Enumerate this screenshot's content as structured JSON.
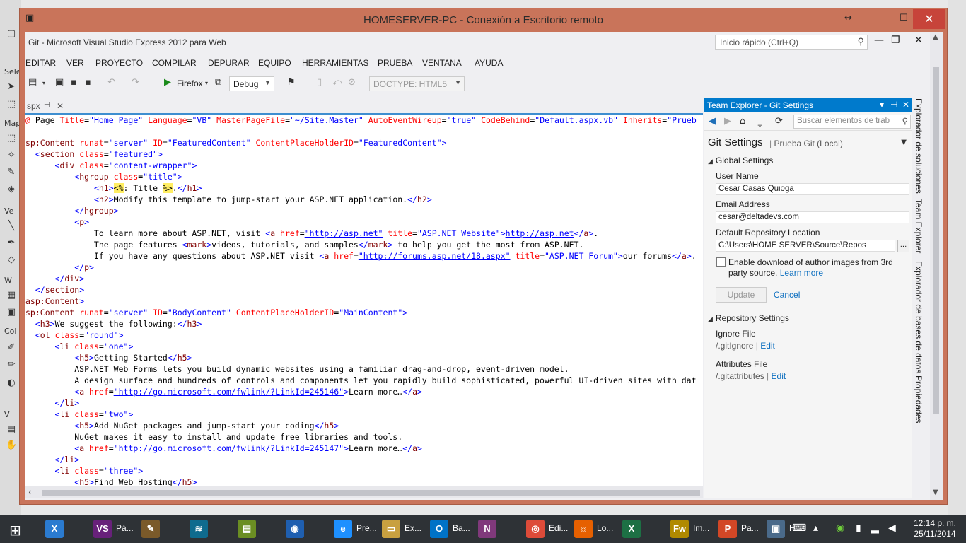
{
  "rdp": {
    "title": "HOMESERVER-PC - Conexión a Escritorio remoto"
  },
  "vs": {
    "title": "Git - Microsoft Visual Studio Express 2012 para Web",
    "quick_launch_placeholder": "Inicio rápido (Ctrl+Q)",
    "menu": [
      "EDITAR",
      "VER",
      "PROYECTO",
      "COMPILAR",
      "DEPURAR",
      "EQUIPO",
      "HERRAMIENTAS",
      "PRUEBA",
      "VENTANA",
      "AYUDA"
    ],
    "toolbar": {
      "browser": "Firefox",
      "config": "Debug",
      "doctype": "DOCTYPE: HTML5"
    },
    "doc_tab": "spx"
  },
  "code": [
    [
      [
        "at",
        "@ "
      ],
      [
        "txt",
        "Page "
      ],
      [
        "at",
        "Title"
      ],
      [
        "txt",
        "="
      ],
      [
        "av",
        "\"Home Page\""
      ],
      [
        "txt",
        " "
      ],
      [
        "at",
        "Language"
      ],
      [
        "txt",
        "="
      ],
      [
        "av",
        "\"VB\""
      ],
      [
        "txt",
        " "
      ],
      [
        "at",
        "MasterPageFile"
      ],
      [
        "txt",
        "="
      ],
      [
        "av",
        "\"~/Site.Master\""
      ],
      [
        "txt",
        " "
      ],
      [
        "at",
        "AutoEventWireup"
      ],
      [
        "txt",
        "="
      ],
      [
        "av",
        "\"true\""
      ],
      [
        "txt",
        " "
      ],
      [
        "at",
        "CodeBehind"
      ],
      [
        "txt",
        "="
      ],
      [
        "av",
        "\"Default.aspx.vb\""
      ],
      [
        "txt",
        " "
      ],
      [
        "at",
        "Inherits"
      ],
      [
        "txt",
        "="
      ],
      [
        "av",
        "\"Prueb"
      ]
    ],
    [],
    [
      [
        "tag",
        "sp:Content "
      ],
      [
        "at",
        "runat"
      ],
      [
        "txt",
        "="
      ],
      [
        "av",
        "\"server\""
      ],
      [
        "txt",
        " "
      ],
      [
        "at",
        "ID"
      ],
      [
        "txt",
        "="
      ],
      [
        "av",
        "\"FeaturedContent\""
      ],
      [
        "txt",
        " "
      ],
      [
        "at",
        "ContentPlaceHolderID"
      ],
      [
        "txt",
        "="
      ],
      [
        "av",
        "\"FeaturedContent\""
      ],
      [
        "av",
        ">"
      ]
    ],
    [
      [
        "txt",
        "  "
      ],
      [
        "av",
        "<"
      ],
      [
        "tag",
        "section "
      ],
      [
        "at",
        "class"
      ],
      [
        "txt",
        "="
      ],
      [
        "av",
        "\"featured\""
      ],
      [
        "av",
        ">"
      ]
    ],
    [
      [
        "txt",
        "      "
      ],
      [
        "av",
        "<"
      ],
      [
        "tag",
        "div "
      ],
      [
        "at",
        "class"
      ],
      [
        "txt",
        "="
      ],
      [
        "av",
        "\"content-wrapper\""
      ],
      [
        "av",
        ">"
      ]
    ],
    [
      [
        "txt",
        "          "
      ],
      [
        "av",
        "<"
      ],
      [
        "tag",
        "hgroup "
      ],
      [
        "at",
        "class"
      ],
      [
        "txt",
        "="
      ],
      [
        "av",
        "\"title\""
      ],
      [
        "av",
        ">"
      ]
    ],
    [
      [
        "txt",
        "              "
      ],
      [
        "av",
        "<"
      ],
      [
        "tag",
        "h1"
      ],
      [
        "av",
        ">"
      ],
      [
        "hl",
        "<%"
      ],
      [
        "txt",
        ": Title "
      ],
      [
        "hl",
        "%>"
      ],
      [
        "txt",
        "."
      ],
      [
        "av",
        "</"
      ],
      [
        "tag",
        "h1"
      ],
      [
        "av",
        ">"
      ]
    ],
    [
      [
        "txt",
        "              "
      ],
      [
        "av",
        "<"
      ],
      [
        "tag",
        "h2"
      ],
      [
        "av",
        ">"
      ],
      [
        "txt",
        "Modify this template to jump-start your ASP.NET application."
      ],
      [
        "av",
        "</"
      ],
      [
        "tag",
        "h2"
      ],
      [
        "av",
        ">"
      ]
    ],
    [
      [
        "txt",
        "          "
      ],
      [
        "av",
        "</"
      ],
      [
        "tag",
        "hgroup"
      ],
      [
        "av",
        ">"
      ]
    ],
    [
      [
        "txt",
        "          "
      ],
      [
        "av",
        "<"
      ],
      [
        "tag",
        "p"
      ],
      [
        "av",
        ">"
      ]
    ],
    [
      [
        "txt",
        "              To learn more about ASP.NET, visit "
      ],
      [
        "av",
        "<"
      ],
      [
        "tag",
        "a "
      ],
      [
        "at",
        "href"
      ],
      [
        "txt",
        "="
      ],
      [
        "url",
        "\"http://asp.net\""
      ],
      [
        "txt",
        " "
      ],
      [
        "at",
        "title"
      ],
      [
        "txt",
        "="
      ],
      [
        "av",
        "\"ASP.NET Website\""
      ],
      [
        "av",
        ">"
      ],
      [
        "url",
        "http://asp.net"
      ],
      [
        "av",
        "</"
      ],
      [
        "tag",
        "a"
      ],
      [
        "av",
        ">"
      ],
      [
        "txt",
        "."
      ]
    ],
    [
      [
        "txt",
        "              The page features "
      ],
      [
        "av",
        "<"
      ],
      [
        "tag",
        "mark"
      ],
      [
        "av",
        ">"
      ],
      [
        "txt",
        "videos, tutorials, and samples"
      ],
      [
        "av",
        "</"
      ],
      [
        "tag",
        "mark"
      ],
      [
        "av",
        ">"
      ],
      [
        "txt",
        " to help you get the most from ASP.NET."
      ]
    ],
    [
      [
        "txt",
        "              If you have any questions about ASP.NET visit "
      ],
      [
        "av",
        "<"
      ],
      [
        "tag",
        "a "
      ],
      [
        "at",
        "href"
      ],
      [
        "txt",
        "="
      ],
      [
        "url",
        "\"http://forums.asp.net/18.aspx\""
      ],
      [
        "txt",
        " "
      ],
      [
        "at",
        "title"
      ],
      [
        "txt",
        "="
      ],
      [
        "av",
        "\"ASP.NET Forum\""
      ],
      [
        "av",
        ">"
      ],
      [
        "txt",
        "our forums"
      ],
      [
        "av",
        "</"
      ],
      [
        "tag",
        "a"
      ],
      [
        "av",
        ">"
      ],
      [
        "txt",
        "."
      ]
    ],
    [
      [
        "txt",
        "          "
      ],
      [
        "av",
        "</"
      ],
      [
        "tag",
        "p"
      ],
      [
        "av",
        ">"
      ]
    ],
    [
      [
        "txt",
        "      "
      ],
      [
        "av",
        "</"
      ],
      [
        "tag",
        "div"
      ],
      [
        "av",
        ">"
      ]
    ],
    [
      [
        "txt",
        "  "
      ],
      [
        "av",
        "</"
      ],
      [
        "tag",
        "section"
      ],
      [
        "av",
        ">"
      ]
    ],
    [
      [
        "tag",
        "asp:Content"
      ],
      [
        "av",
        ">"
      ]
    ],
    [
      [
        "tag",
        "sp:Content "
      ],
      [
        "at",
        "runat"
      ],
      [
        "txt",
        "="
      ],
      [
        "av",
        "\"server\""
      ],
      [
        "txt",
        " "
      ],
      [
        "at",
        "ID"
      ],
      [
        "txt",
        "="
      ],
      [
        "av",
        "\"BodyContent\""
      ],
      [
        "txt",
        " "
      ],
      [
        "at",
        "ContentPlaceHolderID"
      ],
      [
        "txt",
        "="
      ],
      [
        "av",
        "\"MainContent\""
      ],
      [
        "av",
        ">"
      ]
    ],
    [
      [
        "txt",
        "  "
      ],
      [
        "av",
        "<"
      ],
      [
        "tag",
        "h3"
      ],
      [
        "av",
        ">"
      ],
      [
        "txt",
        "We suggest the following:"
      ],
      [
        "av",
        "</"
      ],
      [
        "tag",
        "h3"
      ],
      [
        "av",
        ">"
      ]
    ],
    [
      [
        "txt",
        "  "
      ],
      [
        "av",
        "<"
      ],
      [
        "tag",
        "ol "
      ],
      [
        "at",
        "class"
      ],
      [
        "txt",
        "="
      ],
      [
        "av",
        "\"round\""
      ],
      [
        "av",
        ">"
      ]
    ],
    [
      [
        "txt",
        "      "
      ],
      [
        "av",
        "<"
      ],
      [
        "tag",
        "li "
      ],
      [
        "at",
        "class"
      ],
      [
        "txt",
        "="
      ],
      [
        "av",
        "\"one\""
      ],
      [
        "av",
        ">"
      ]
    ],
    [
      [
        "txt",
        "          "
      ],
      [
        "av",
        "<"
      ],
      [
        "tag",
        "h5"
      ],
      [
        "av",
        ">"
      ],
      [
        "txt",
        "Getting Started"
      ],
      [
        "av",
        "</"
      ],
      [
        "tag",
        "h5"
      ],
      [
        "av",
        ">"
      ]
    ],
    [
      [
        "txt",
        "          ASP.NET Web Forms lets you build dynamic websites using a familiar drag-and-drop, event-driven model."
      ]
    ],
    [
      [
        "txt",
        "          A design surface and hundreds of controls and components let you rapidly build sophisticated, powerful UI-driven sites with dat"
      ]
    ],
    [
      [
        "txt",
        "          "
      ],
      [
        "av",
        "<"
      ],
      [
        "tag",
        "a "
      ],
      [
        "at",
        "href"
      ],
      [
        "txt",
        "="
      ],
      [
        "url",
        "\"http://go.microsoft.com/fwlink/?LinkId=245146\""
      ],
      [
        "av",
        ">"
      ],
      [
        "txt",
        "Learn more…"
      ],
      [
        "av",
        "</"
      ],
      [
        "tag",
        "a"
      ],
      [
        "av",
        ">"
      ]
    ],
    [
      [
        "txt",
        "      "
      ],
      [
        "av",
        "</"
      ],
      [
        "tag",
        "li"
      ],
      [
        "av",
        ">"
      ]
    ],
    [
      [
        "txt",
        "      "
      ],
      [
        "av",
        "<"
      ],
      [
        "tag",
        "li "
      ],
      [
        "at",
        "class"
      ],
      [
        "txt",
        "="
      ],
      [
        "av",
        "\"two\""
      ],
      [
        "av",
        ">"
      ]
    ],
    [
      [
        "txt",
        "          "
      ],
      [
        "av",
        "<"
      ],
      [
        "tag",
        "h5"
      ],
      [
        "av",
        ">"
      ],
      [
        "txt",
        "Add NuGet packages and jump-start your coding"
      ],
      [
        "av",
        "</"
      ],
      [
        "tag",
        "h5"
      ],
      [
        "av",
        ">"
      ]
    ],
    [
      [
        "txt",
        "          NuGet makes it easy to install and update free libraries and tools."
      ]
    ],
    [
      [
        "txt",
        "          "
      ],
      [
        "av",
        "<"
      ],
      [
        "tag",
        "a "
      ],
      [
        "at",
        "href"
      ],
      [
        "txt",
        "="
      ],
      [
        "url",
        "\"http://go.microsoft.com/fwlink/?LinkId=245147\""
      ],
      [
        "av",
        ">"
      ],
      [
        "txt",
        "Learn more…"
      ],
      [
        "av",
        "</"
      ],
      [
        "tag",
        "a"
      ],
      [
        "av",
        ">"
      ]
    ],
    [
      [
        "txt",
        "      "
      ],
      [
        "av",
        "</"
      ],
      [
        "tag",
        "li"
      ],
      [
        "av",
        ">"
      ]
    ],
    [
      [
        "txt",
        "      "
      ],
      [
        "av",
        "<"
      ],
      [
        "tag",
        "li "
      ],
      [
        "at",
        "class"
      ],
      [
        "txt",
        "="
      ],
      [
        "av",
        "\"three\""
      ],
      [
        "av",
        ">"
      ]
    ],
    [
      [
        "txt",
        "          "
      ],
      [
        "av",
        "<"
      ],
      [
        "tag",
        "h5"
      ],
      [
        "av",
        ">"
      ],
      [
        "txt",
        "Find Web Hosting"
      ],
      [
        "av",
        "</"
      ],
      [
        "tag",
        "h5"
      ],
      [
        "av",
        ">"
      ]
    ]
  ],
  "team": {
    "header": "Team Explorer - Git Settings",
    "search_placeholder": "Buscar elementos de trab",
    "title": "Git Settings",
    "subtitle": "Prueba Git (Local)",
    "global_section": "Global Settings",
    "user_name_label": "User Name",
    "user_name": "Cesar Casas Quioga",
    "email_label": "Email Address",
    "email": "cesar@deltadevs.com",
    "repo_loc_label": "Default Repository Location",
    "repo_loc": "C:\\Users\\HOME SERVER\\Source\\Repos",
    "browse": "...",
    "checkbox_label": "Enable download of author images from 3rd party source.",
    "learn_more": "Learn more",
    "update": "Update",
    "cancel": "Cancel",
    "repo_section": "Repository Settings",
    "ignore_label": "Ignore File",
    "ignore_value": "/.gitIgnore",
    "attr_label": "Attributes File",
    "attr_value": "/.gitattributes",
    "edit": "Edit",
    "separator": "|"
  },
  "vtabs": [
    "Explorador de soluciones",
    "Team Explorer",
    "Explorador de bases de datos",
    "Propiedades"
  ],
  "taskbar": {
    "items": [
      {
        "icon": "X",
        "label": "",
        "color": "#2b7bd0"
      },
      {
        "icon": "VS",
        "label": "Pá...",
        "color": "#68217a"
      },
      {
        "icon": "✎",
        "label": "",
        "color": "#7a5a2a"
      },
      {
        "icon": "≋",
        "label": "",
        "color": "#0f6b8e"
      },
      {
        "icon": "▤",
        "label": "",
        "color": "#6b8e23"
      },
      {
        "icon": "◉",
        "label": "",
        "color": "#1f5fb0"
      },
      {
        "icon": "e",
        "label": "Pre...",
        "color": "#1e90ff"
      },
      {
        "icon": "▭",
        "label": "Ex...",
        "color": "#c8a040"
      },
      {
        "icon": "O",
        "label": "Ba...",
        "color": "#0072c6"
      },
      {
        "icon": "N",
        "label": "",
        "color": "#80397b"
      },
      {
        "icon": "◎",
        "label": "Edi...",
        "color": "#dd4b39"
      },
      {
        "icon": "☼",
        "label": "Lo...",
        "color": "#e66000"
      },
      {
        "icon": "X",
        "label": "",
        "color": "#1d7044"
      },
      {
        "icon": "Fw",
        "label": "Im...",
        "color": "#b08900"
      },
      {
        "icon": "P",
        "label": "Pa...",
        "color": "#d24726"
      },
      {
        "icon": "▣",
        "label": "H...",
        "color": "#4a6a8a"
      }
    ],
    "time": "12:14 p. m.",
    "date": "25/11/2014"
  }
}
